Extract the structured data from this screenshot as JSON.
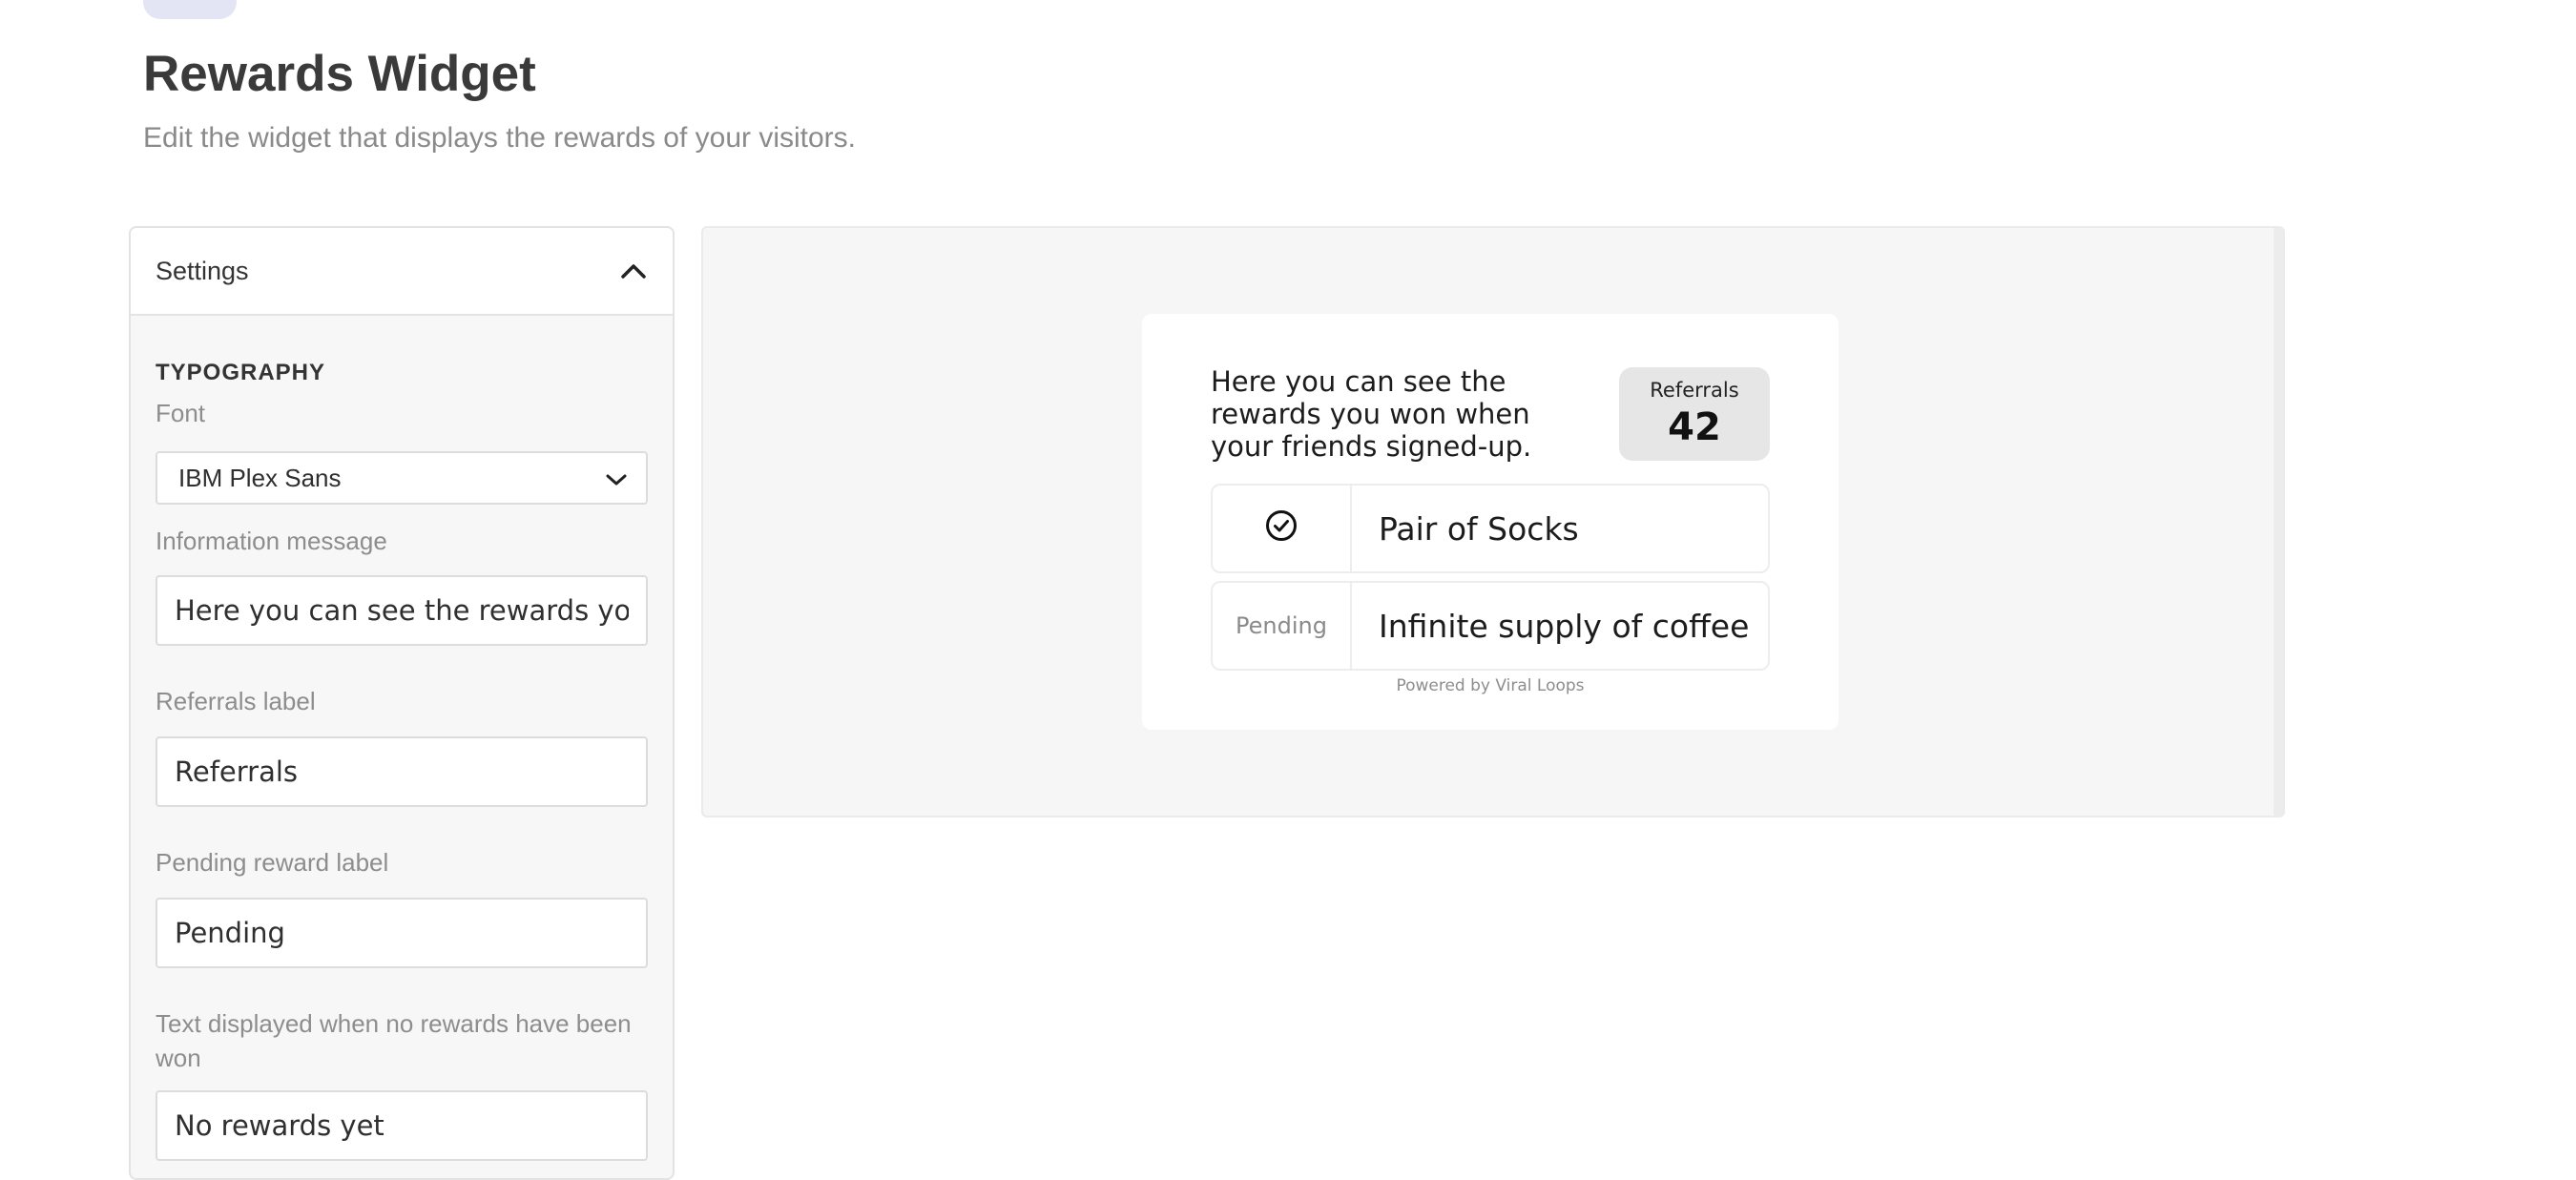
{
  "header": {
    "title": "Rewards Widget",
    "subtitle": "Edit the widget that displays the rewards of your visitors."
  },
  "settings": {
    "header_label": "Settings",
    "typography_title": "TYPOGRAPHY",
    "font_label": "Font",
    "font_value": "IBM Plex Sans",
    "info_message_label": "Information message",
    "info_message_value": "Here you can see the rewards you won when your friends signed-up.",
    "referrals_label": "Referrals label",
    "referrals_value": "Referrals",
    "pending_label": "Pending reward label",
    "pending_value": "Pending",
    "no_rewards_label": "Text displayed when no rewards have been won",
    "no_rewards_value": "No rewards yet"
  },
  "preview": {
    "info_message": "Here you can see the rewards you won when your friends signed-up.",
    "referrals_label": "Referrals",
    "referrals_count": "42",
    "rewards": [
      {
        "status": "check-circle-icon",
        "name": "Pair of Socks"
      },
      {
        "status": "Pending",
        "name": "Infinite supply of coffee"
      }
    ],
    "powered_by": "Powered by Viral Loops"
  },
  "colors": {
    "accent_pill": "#e4e5f4",
    "panel_background": "#f7f7f7",
    "preview_background": "#f6f6f6",
    "referrals_box": "#e6e6e6"
  }
}
